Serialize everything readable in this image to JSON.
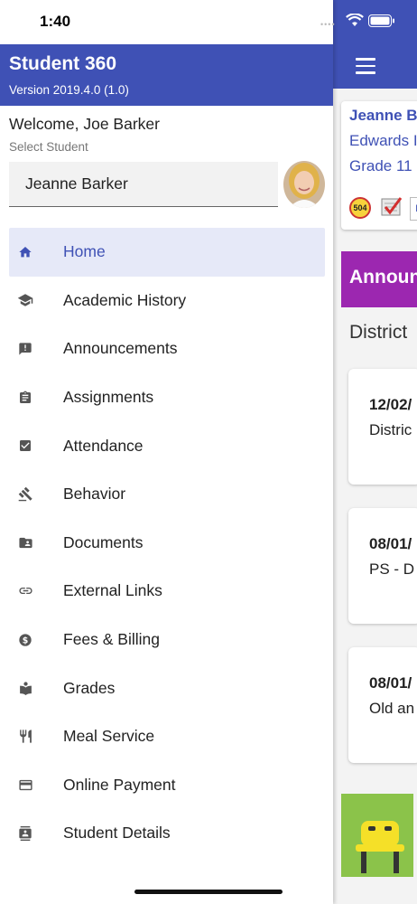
{
  "status_bar": {
    "time": "1:40"
  },
  "drawer": {
    "app_title": "Student 360",
    "version": "Version 2019.4.0 (1.0)",
    "welcome": "Welcome, Joe Barker",
    "select_label": "Select Student",
    "selected_student": "Jeanne Barker",
    "menu": [
      {
        "label": "Home",
        "icon": "home-icon",
        "active": true
      },
      {
        "label": "Academic History",
        "icon": "graduation-cap-icon"
      },
      {
        "label": "Announcements",
        "icon": "announcement-icon"
      },
      {
        "label": "Assignments",
        "icon": "clipboard-icon"
      },
      {
        "label": "Attendance",
        "icon": "checkbox-icon"
      },
      {
        "label": "Behavior",
        "icon": "gavel-icon"
      },
      {
        "label": "Documents",
        "icon": "folder-shared-icon"
      },
      {
        "label": "External Links",
        "icon": "link-icon"
      },
      {
        "label": "Fees & Billing",
        "icon": "dollar-icon"
      },
      {
        "label": "Grades",
        "icon": "reading-icon"
      },
      {
        "label": "Meal Service",
        "icon": "utensils-icon"
      },
      {
        "label": "Online Payment",
        "icon": "credit-card-icon"
      },
      {
        "label": "Student Details",
        "icon": "contact-card-icon"
      }
    ]
  },
  "background": {
    "student_name": "Jeanne B",
    "school": "Edwards I",
    "grade": "Grade 11",
    "badge_504": "504",
    "badge_e": "E",
    "announcements_title": "Announ",
    "district_heading": "District",
    "announcement_cards": [
      {
        "date": "12/02/",
        "text": "Distric"
      },
      {
        "date": "08/01/",
        "text": "PS - D"
      },
      {
        "date": "08/01/",
        "text": "Old an"
      }
    ]
  },
  "colors": {
    "primary": "#3f51b5",
    "announcement_band": "#9c27b0",
    "tile": "#8bc34a",
    "active_row": "#e6e9f8"
  }
}
